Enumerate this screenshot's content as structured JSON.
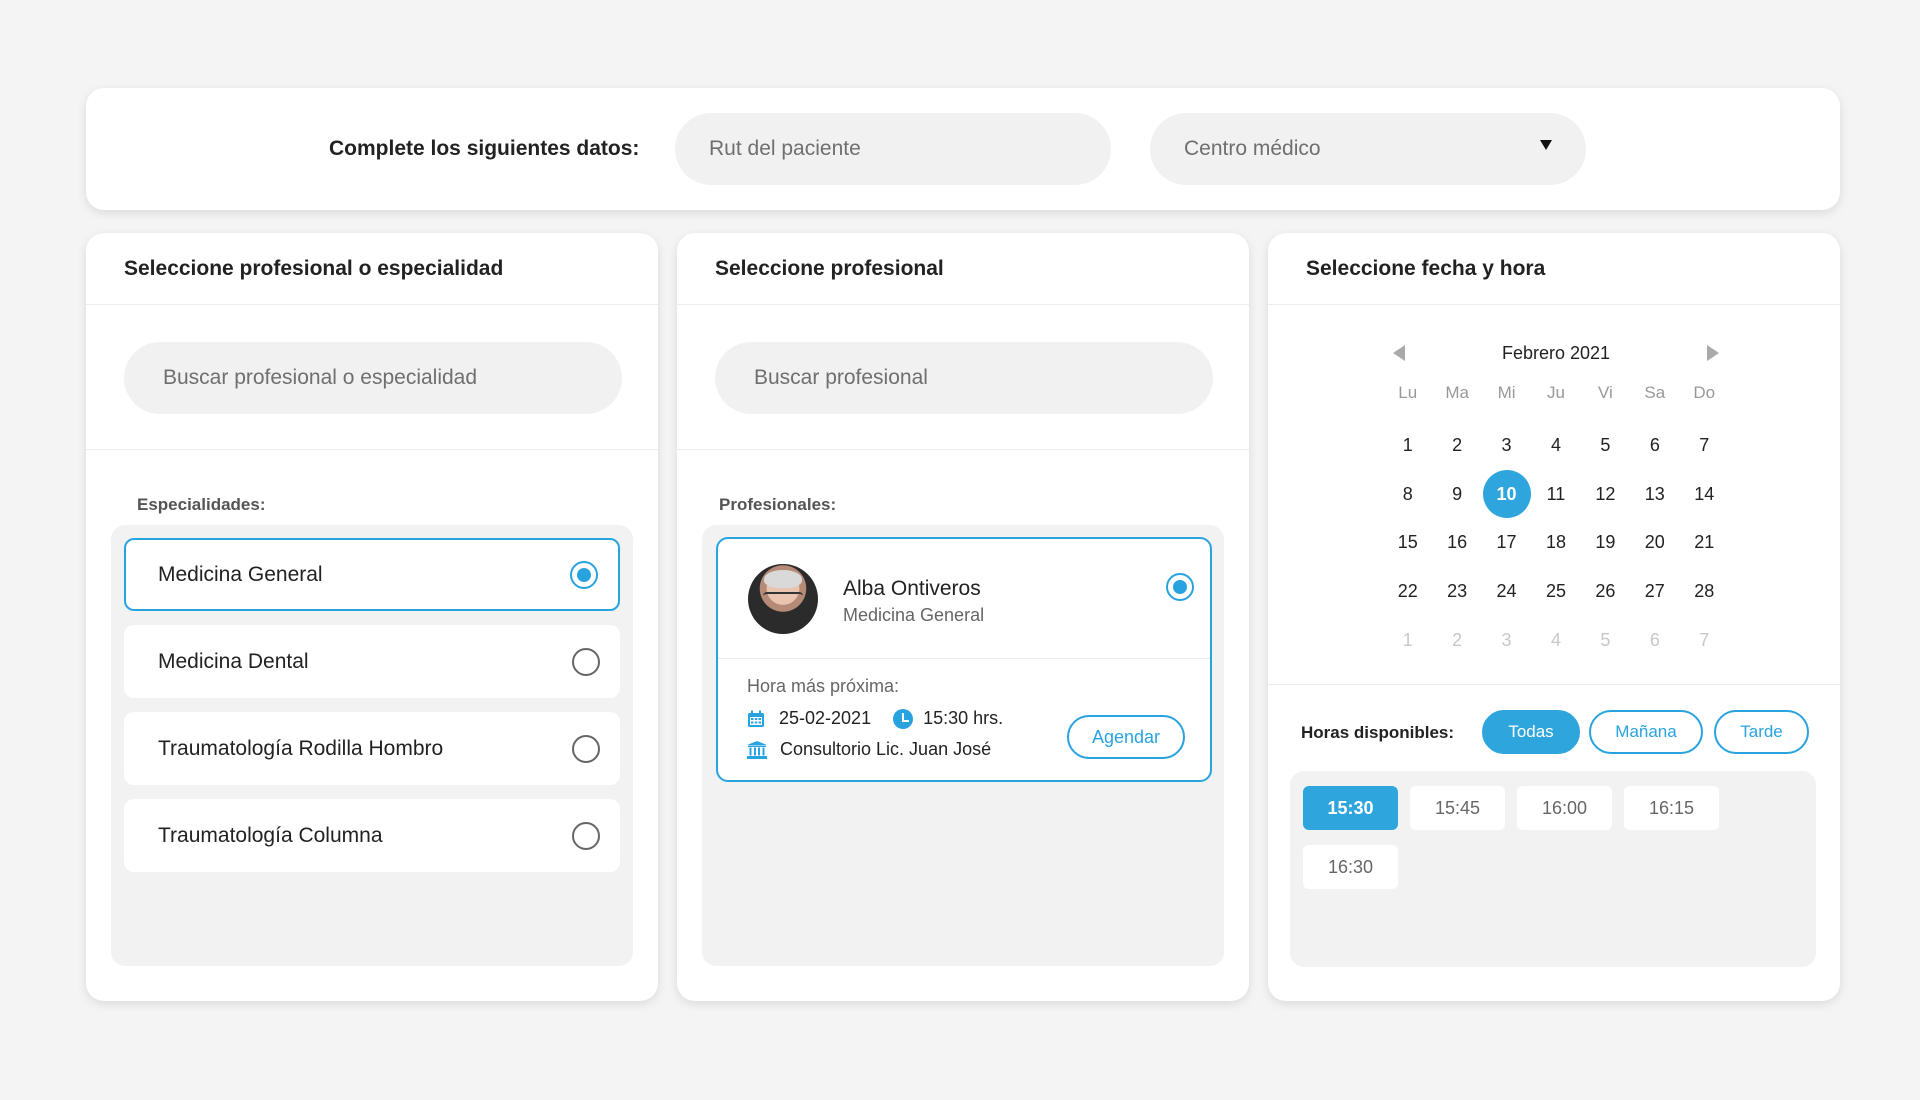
{
  "top": {
    "label": "Complete los siguientes datos:",
    "rut_placeholder": "Rut del paciente",
    "centro_placeholder": "Centro médico"
  },
  "col1": {
    "title": "Seleccione profesional o especialidad",
    "search_placeholder": "Buscar profesional o especialidad",
    "section_label": "Especialidades:",
    "items": [
      {
        "label": "Medicina General",
        "selected": true
      },
      {
        "label": "Medicina Dental",
        "selected": false
      },
      {
        "label": "Traumatología Rodilla Hombro",
        "selected": false
      },
      {
        "label": "Traumatología Columna",
        "selected": false
      }
    ]
  },
  "col2": {
    "title": "Seleccione profesional",
    "search_placeholder": "Buscar profesional",
    "section_label": "Profesionales:",
    "professional": {
      "name": "Alba Ontiveros",
      "specialty": "Medicina General",
      "next_label": "Hora más próxima:",
      "date": "25-02-2021",
      "time": "15:30 hrs.",
      "place": "Consultorio Lic. Juan José",
      "button": "Agendar"
    }
  },
  "col3": {
    "title": "Seleccione fecha y hora",
    "calendar": {
      "month": "Febrero 2021",
      "weekdays": [
        "Lu",
        "Ma",
        "Mi",
        "Ju",
        "Vi",
        "Sa",
        "Do"
      ],
      "weeks": [
        [
          "1",
          "2",
          "3",
          "4",
          "5",
          "6",
          "7"
        ],
        [
          "8",
          "9",
          "10",
          "11",
          "12",
          "13",
          "14"
        ],
        [
          "15",
          "16",
          "17",
          "18",
          "19",
          "20",
          "21"
        ],
        [
          "22",
          "23",
          "24",
          "25",
          "26",
          "27",
          "28"
        ],
        [
          "1",
          "2",
          "3",
          "4",
          "5",
          "6",
          "7"
        ]
      ],
      "selected_day": "10"
    },
    "hours_label": "Horas disponibles:",
    "filters": {
      "todas": "Todas",
      "manana": "Mañana",
      "tarde": "Tarde"
    },
    "slots": [
      "15:30",
      "15:45",
      "16:00",
      "16:15",
      "16:30"
    ],
    "selected_slot": "15:30"
  },
  "colors": {
    "accent": "#29a3df",
    "background": "#f4f4f4"
  }
}
